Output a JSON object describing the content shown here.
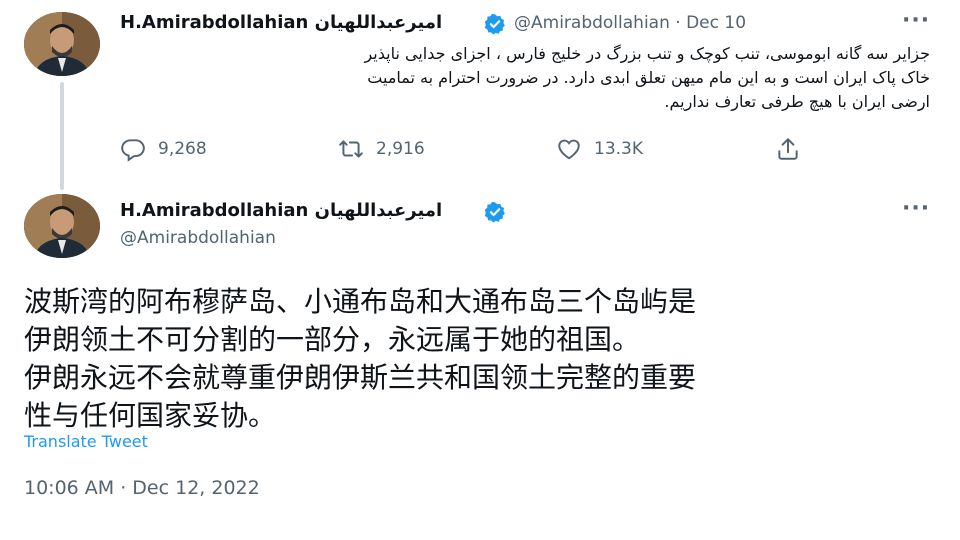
{
  "tweet1": {
    "display_name": "H.Amirabdollahian",
    "display_name_fa": "امیرعبداللهیان",
    "handle": "@Amirabdollahian",
    "separator": "·",
    "date": "Dec 10",
    "more_label": "···",
    "text_lines": [
      "جزایر سه گانه ابوموسی، تنب کوچک و تنب بزرگ در خلیج فارس ، اجزای جدایی ناپذیر",
      "خاک پاک ایران است و به این مام میهن تعلق ابدی دارد. در ضرورت احترام به تمامیت",
      "ارضی ایران با هیچ طرفی تعارف نداریم."
    ],
    "actions": {
      "replies": "9,268",
      "retweets": "2,916",
      "likes": "13.3K"
    }
  },
  "tweet2": {
    "display_name": "H.Amirabdollahian",
    "display_name_fa": "امیرعبداللهیان",
    "handle": "@Amirabdollahian",
    "more_label": "···",
    "text_lines": [
      "波斯湾的阿布穆萨岛、小通布岛和大通布岛三个岛屿是",
      "伊朗领土不可分割的一部分，永远属于她的祖国。",
      "伊朗永远不会就尊重伊朗伊斯兰共和国领土完整的重要",
      "性与任何国家妥协。"
    ],
    "translate_label": "Translate Tweet",
    "timestamp": "10:06 AM · Dec 12, 2022"
  },
  "colors": {
    "accent": "#1d9bf0",
    "secondary_text": "#536471",
    "primary_text": "#0f1419",
    "thread_line": "#cfd9de"
  }
}
